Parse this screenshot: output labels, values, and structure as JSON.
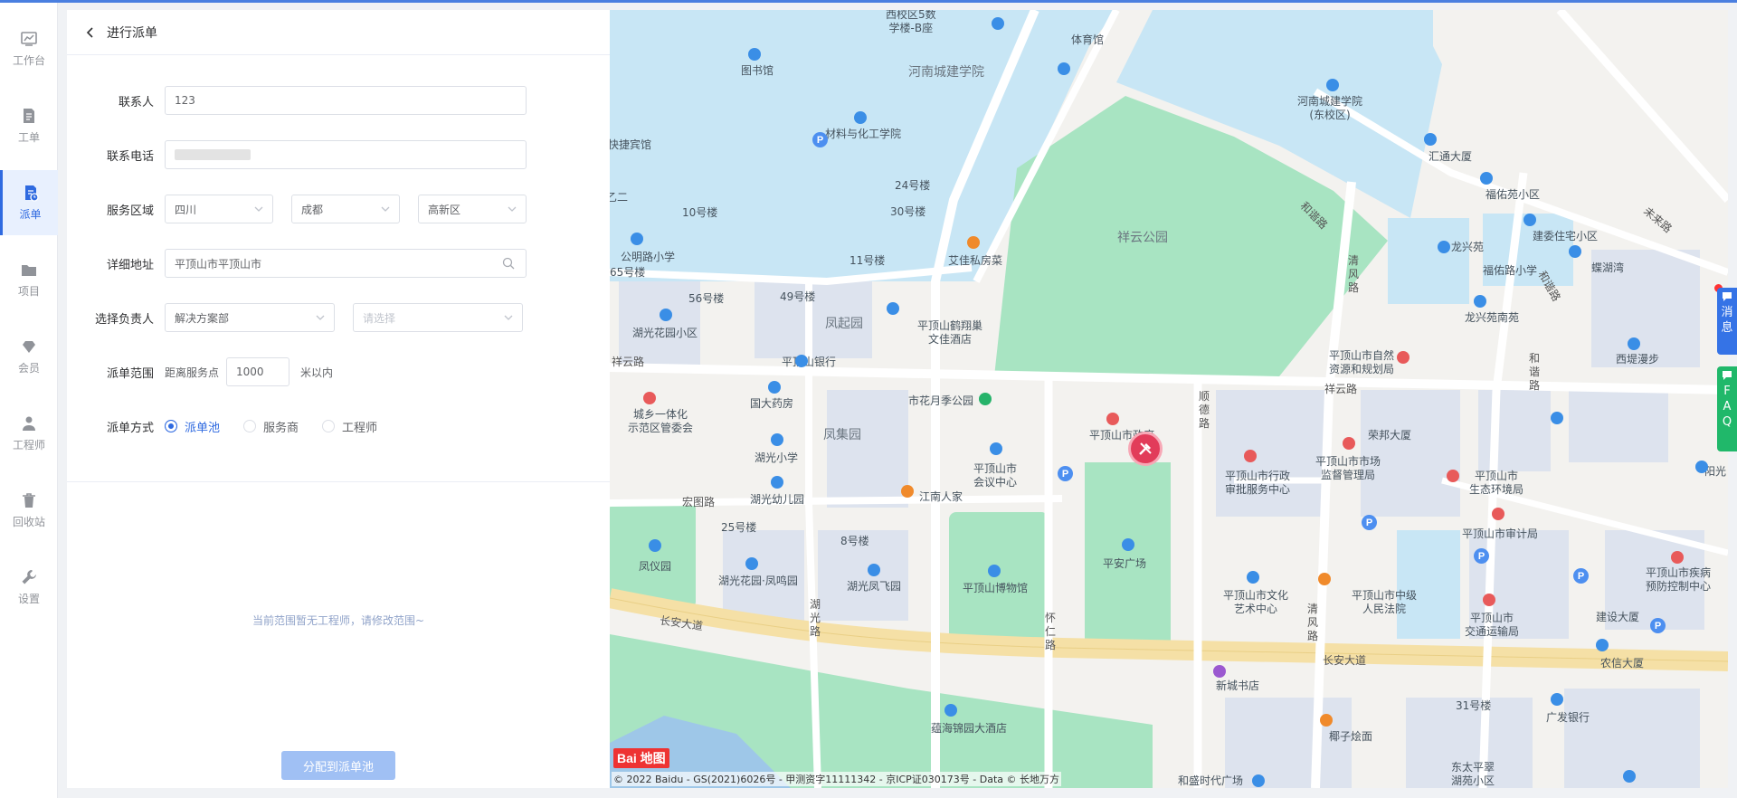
{
  "nav": [
    {
      "label": "工作台",
      "icon": "dashboard-icon"
    },
    {
      "label": "工单",
      "icon": "document-icon"
    },
    {
      "label": "派单",
      "icon": "dispatch-icon"
    },
    {
      "label": "项目",
      "icon": "folder-icon"
    },
    {
      "label": "会员",
      "icon": "member-icon"
    },
    {
      "label": "工程师",
      "icon": "engineer-icon"
    },
    {
      "label": "回收站",
      "icon": "trash-icon"
    },
    {
      "label": "设置",
      "icon": "wrench-icon"
    }
  ],
  "active_nav": "派单",
  "panel": {
    "title": "进行派单",
    "contact_label": "联系人",
    "contact_value": "123",
    "phone_label": "联系电话",
    "area_label": "服务区域",
    "province": "四川",
    "city": "成都",
    "district": "高新区",
    "address_label": "详细地址",
    "address_value": "平顶山市平顶山市",
    "owner_label": "选择负责人",
    "owner_value": "解决方案部",
    "owner2_placeholder": "请选择",
    "range_label": "派单范围",
    "range_prefix": "距离服务点",
    "range_value": "1000",
    "range_suffix": "米以内",
    "mode_label": "派单方式",
    "modes": [
      "派单池",
      "服务商",
      "工程师"
    ],
    "selected_mode": "派单池",
    "empty_text": "当前范围暂无工程师，请修改范围~",
    "assign_button": "分配到派单池"
  },
  "map": {
    "labels": {
      "l1": "西校区5数\n学楼-B座",
      "l2": "体育馆",
      "l3": "图书馆",
      "l4": "河南城建学院",
      "l5": "河南城建学院\n(东校区)",
      "l6": "材料与化工学院",
      "l7": "汇通大厦",
      "l8": "福佑苑小区",
      "l9": "24号楼",
      "l10": "30号楼",
      "l11": "10号楼",
      "l12": "祥云公园",
      "l13": "建委住宅小区",
      "l14": "龙兴苑",
      "l15": "福佑路小学",
      "l16": "蝶湖湾",
      "l17": "公明路小学",
      "l18": "11号楼",
      "l19": "艾佳私房菜",
      "l20": "56号楼",
      "l21": "49号楼",
      "l22": "凤起园",
      "l23": "平顶山鹤翔巢\n文佳酒店",
      "l24": "龙兴苑南苑",
      "l25": "湖光花园小区",
      "l26": "平顶山银行",
      "l27": "平顶山市自然\n资源和规划局",
      "l28": "西堤漫步",
      "l29": "祥云路",
      "l30": "城乡一体化\n示范区管委会",
      "l31": "国大药房",
      "l32": "市花月季公园",
      "l33": "凤集园",
      "l34": "平顶山市政府",
      "l35": "荣邦大厦",
      "l36": "湖光小学",
      "l37": "平顶山市\n会议中心",
      "l38": "平顶山市行政\n审批服务中心",
      "l39": "平顶山市市场\n监督管理局",
      "l40": "平顶山市\n生态环境局",
      "l41": "湖光幼儿园",
      "l42": "江南人家",
      "l43": "宏图路",
      "l44": "25号楼",
      "l45": "8号楼",
      "l46": "平顶山市审计局",
      "l47": "凤仪园",
      "l48": "湖光花园·凤鸣园",
      "l49": "湖光凤飞园",
      "l50": "平顶山博物馆",
      "l51": "平安广场",
      "l52": "平顶山市文化\n艺术中心",
      "l53": "平顶山市中级\n人民法院",
      "l54": "平顶山市\n交通运输局",
      "l55": "平顶山市疾病\n预防控制中心",
      "l56": "建设大厦",
      "l57": "长安大道",
      "l58": "长安大道",
      "l59": "新城书店",
      "l60": "农信大厦",
      "l61": "蕴海锦园大酒店",
      "l62": "31号楼",
      "l63": "广发银行",
      "l64": "东太平翠\n湖苑小区",
      "l65": "椰子烩面",
      "l66": "和盛时代广场",
      "l67": "快捷宾馆",
      "l68": "65号楼",
      "l69": "和谐路",
      "l70": "清风路",
      "l71": "顺德路",
      "l72": "湖光路",
      "l73": "怀仁路",
      "l74": "清风路",
      "l75": "和谐路",
      "l76": "未来路",
      "l77": "和谐路",
      "l78": "阳光",
      "l79": "祥云路",
      "l80": "乙二"
    },
    "logo": "Bai 地图",
    "copyright": "© 2022 Baidu - GS(2021)6026号 - 甲测资字11111342 - 京ICP证030173号 - Data © 长地万方"
  },
  "side_tabs": {
    "message": "消息",
    "faq": [
      "F",
      "A",
      "Q"
    ]
  },
  "colors": {
    "accent": "#2f6ae0",
    "assign_button": "#a0c0f4",
    "park_green": "#a8e4c2",
    "campus_blue": "#c8e6f5",
    "marker_red": "#e23c5a"
  }
}
